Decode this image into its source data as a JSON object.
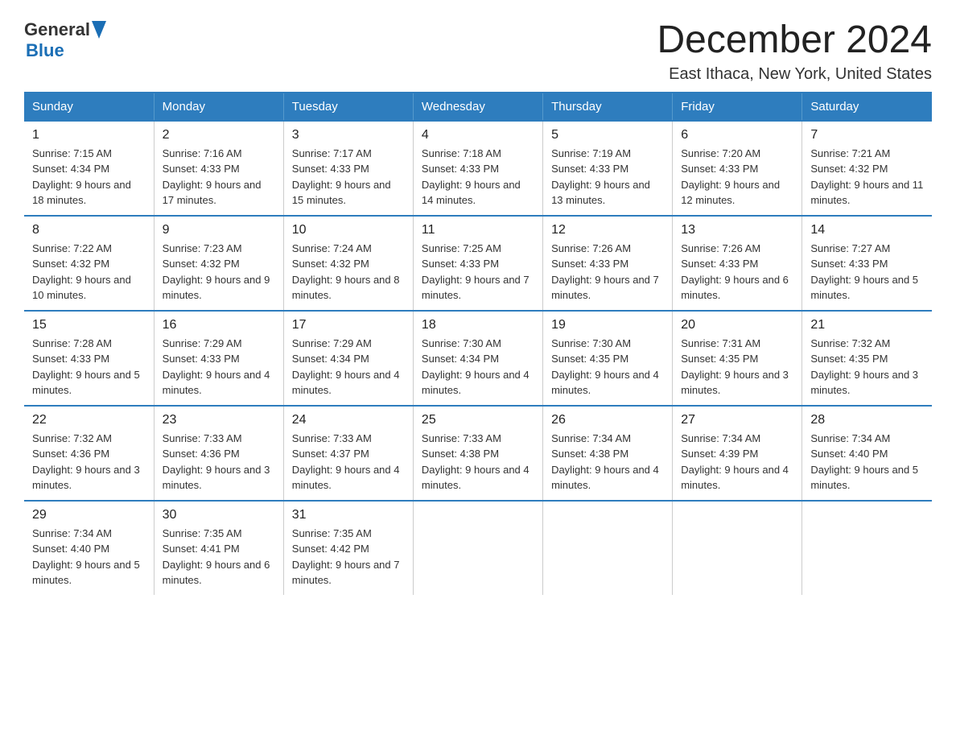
{
  "logo": {
    "line1_text": "General",
    "line2_text": "Blue"
  },
  "header": {
    "title": "December 2024",
    "subtitle": "East Ithaca, New York, United States"
  },
  "days_of_week": [
    "Sunday",
    "Monday",
    "Tuesday",
    "Wednesday",
    "Thursday",
    "Friday",
    "Saturday"
  ],
  "weeks": [
    [
      {
        "day": "1",
        "sunrise": "Sunrise: 7:15 AM",
        "sunset": "Sunset: 4:34 PM",
        "daylight": "Daylight: 9 hours and 18 minutes."
      },
      {
        "day": "2",
        "sunrise": "Sunrise: 7:16 AM",
        "sunset": "Sunset: 4:33 PM",
        "daylight": "Daylight: 9 hours and 17 minutes."
      },
      {
        "day": "3",
        "sunrise": "Sunrise: 7:17 AM",
        "sunset": "Sunset: 4:33 PM",
        "daylight": "Daylight: 9 hours and 15 minutes."
      },
      {
        "day": "4",
        "sunrise": "Sunrise: 7:18 AM",
        "sunset": "Sunset: 4:33 PM",
        "daylight": "Daylight: 9 hours and 14 minutes."
      },
      {
        "day": "5",
        "sunrise": "Sunrise: 7:19 AM",
        "sunset": "Sunset: 4:33 PM",
        "daylight": "Daylight: 9 hours and 13 minutes."
      },
      {
        "day": "6",
        "sunrise": "Sunrise: 7:20 AM",
        "sunset": "Sunset: 4:33 PM",
        "daylight": "Daylight: 9 hours and 12 minutes."
      },
      {
        "day": "7",
        "sunrise": "Sunrise: 7:21 AM",
        "sunset": "Sunset: 4:32 PM",
        "daylight": "Daylight: 9 hours and 11 minutes."
      }
    ],
    [
      {
        "day": "8",
        "sunrise": "Sunrise: 7:22 AM",
        "sunset": "Sunset: 4:32 PM",
        "daylight": "Daylight: 9 hours and 10 minutes."
      },
      {
        "day": "9",
        "sunrise": "Sunrise: 7:23 AM",
        "sunset": "Sunset: 4:32 PM",
        "daylight": "Daylight: 9 hours and 9 minutes."
      },
      {
        "day": "10",
        "sunrise": "Sunrise: 7:24 AM",
        "sunset": "Sunset: 4:32 PM",
        "daylight": "Daylight: 9 hours and 8 minutes."
      },
      {
        "day": "11",
        "sunrise": "Sunrise: 7:25 AM",
        "sunset": "Sunset: 4:33 PM",
        "daylight": "Daylight: 9 hours and 7 minutes."
      },
      {
        "day": "12",
        "sunrise": "Sunrise: 7:26 AM",
        "sunset": "Sunset: 4:33 PM",
        "daylight": "Daylight: 9 hours and 7 minutes."
      },
      {
        "day": "13",
        "sunrise": "Sunrise: 7:26 AM",
        "sunset": "Sunset: 4:33 PM",
        "daylight": "Daylight: 9 hours and 6 minutes."
      },
      {
        "day": "14",
        "sunrise": "Sunrise: 7:27 AM",
        "sunset": "Sunset: 4:33 PM",
        "daylight": "Daylight: 9 hours and 5 minutes."
      }
    ],
    [
      {
        "day": "15",
        "sunrise": "Sunrise: 7:28 AM",
        "sunset": "Sunset: 4:33 PM",
        "daylight": "Daylight: 9 hours and 5 minutes."
      },
      {
        "day": "16",
        "sunrise": "Sunrise: 7:29 AM",
        "sunset": "Sunset: 4:33 PM",
        "daylight": "Daylight: 9 hours and 4 minutes."
      },
      {
        "day": "17",
        "sunrise": "Sunrise: 7:29 AM",
        "sunset": "Sunset: 4:34 PM",
        "daylight": "Daylight: 9 hours and 4 minutes."
      },
      {
        "day": "18",
        "sunrise": "Sunrise: 7:30 AM",
        "sunset": "Sunset: 4:34 PM",
        "daylight": "Daylight: 9 hours and 4 minutes."
      },
      {
        "day": "19",
        "sunrise": "Sunrise: 7:30 AM",
        "sunset": "Sunset: 4:35 PM",
        "daylight": "Daylight: 9 hours and 4 minutes."
      },
      {
        "day": "20",
        "sunrise": "Sunrise: 7:31 AM",
        "sunset": "Sunset: 4:35 PM",
        "daylight": "Daylight: 9 hours and 3 minutes."
      },
      {
        "day": "21",
        "sunrise": "Sunrise: 7:32 AM",
        "sunset": "Sunset: 4:35 PM",
        "daylight": "Daylight: 9 hours and 3 minutes."
      }
    ],
    [
      {
        "day": "22",
        "sunrise": "Sunrise: 7:32 AM",
        "sunset": "Sunset: 4:36 PM",
        "daylight": "Daylight: 9 hours and 3 minutes."
      },
      {
        "day": "23",
        "sunrise": "Sunrise: 7:33 AM",
        "sunset": "Sunset: 4:36 PM",
        "daylight": "Daylight: 9 hours and 3 minutes."
      },
      {
        "day": "24",
        "sunrise": "Sunrise: 7:33 AM",
        "sunset": "Sunset: 4:37 PM",
        "daylight": "Daylight: 9 hours and 4 minutes."
      },
      {
        "day": "25",
        "sunrise": "Sunrise: 7:33 AM",
        "sunset": "Sunset: 4:38 PM",
        "daylight": "Daylight: 9 hours and 4 minutes."
      },
      {
        "day": "26",
        "sunrise": "Sunrise: 7:34 AM",
        "sunset": "Sunset: 4:38 PM",
        "daylight": "Daylight: 9 hours and 4 minutes."
      },
      {
        "day": "27",
        "sunrise": "Sunrise: 7:34 AM",
        "sunset": "Sunset: 4:39 PM",
        "daylight": "Daylight: 9 hours and 4 minutes."
      },
      {
        "day": "28",
        "sunrise": "Sunrise: 7:34 AM",
        "sunset": "Sunset: 4:40 PM",
        "daylight": "Daylight: 9 hours and 5 minutes."
      }
    ],
    [
      {
        "day": "29",
        "sunrise": "Sunrise: 7:34 AM",
        "sunset": "Sunset: 4:40 PM",
        "daylight": "Daylight: 9 hours and 5 minutes."
      },
      {
        "day": "30",
        "sunrise": "Sunrise: 7:35 AM",
        "sunset": "Sunset: 4:41 PM",
        "daylight": "Daylight: 9 hours and 6 minutes."
      },
      {
        "day": "31",
        "sunrise": "Sunrise: 7:35 AM",
        "sunset": "Sunset: 4:42 PM",
        "daylight": "Daylight: 9 hours and 7 minutes."
      },
      null,
      null,
      null,
      null
    ]
  ]
}
